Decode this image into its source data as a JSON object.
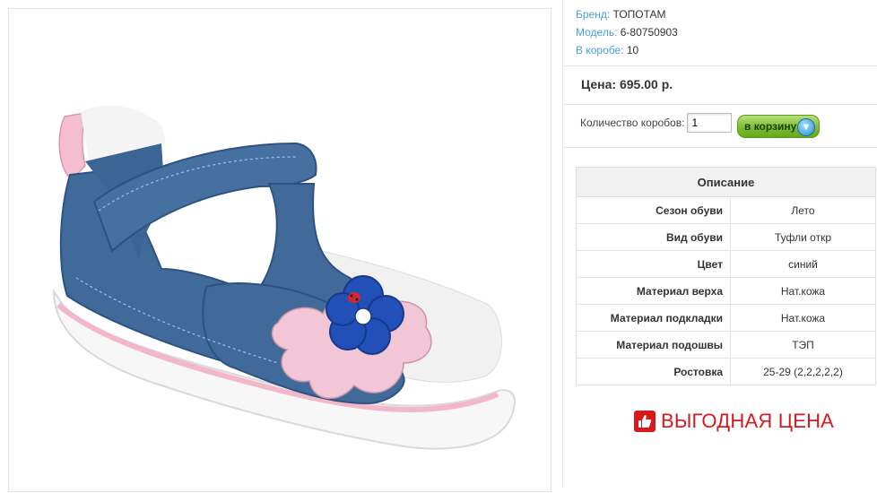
{
  "product": {
    "brand_label": "Бренд:",
    "brand": "ТОПОТАМ",
    "model_label": "Модель:",
    "model": "6-80750903",
    "box_label": "В коробе:",
    "box_count": "10",
    "price_text": "Цена: 695.00 р."
  },
  "order": {
    "qty_label": "Количество коробов:",
    "qty_value": "1",
    "cart_button": "в корзину"
  },
  "description": {
    "title": "Описание",
    "rows": [
      {
        "name": "Сезон обуви",
        "value": "Лето"
      },
      {
        "name": "Вид обуви",
        "value": "Туфли откр"
      },
      {
        "name": "Цвет",
        "value": "синий"
      },
      {
        "name": "Материал верха",
        "value": "Нат.кожа"
      },
      {
        "name": "Материал подкладки",
        "value": "Нат.кожа"
      },
      {
        "name": "Материал подошвы",
        "value": "ТЭП"
      },
      {
        "name": "Ростовка",
        "value": "25-29 (2,2,2,2,2)"
      }
    ]
  },
  "promo": {
    "text": "ВЫГОДНАЯ ЦЕНА",
    "icon": "thumbs-up-icon"
  },
  "colors": {
    "link": "#4a9fd6",
    "promo": "#d7191e",
    "button": "#7dbd2f"
  }
}
